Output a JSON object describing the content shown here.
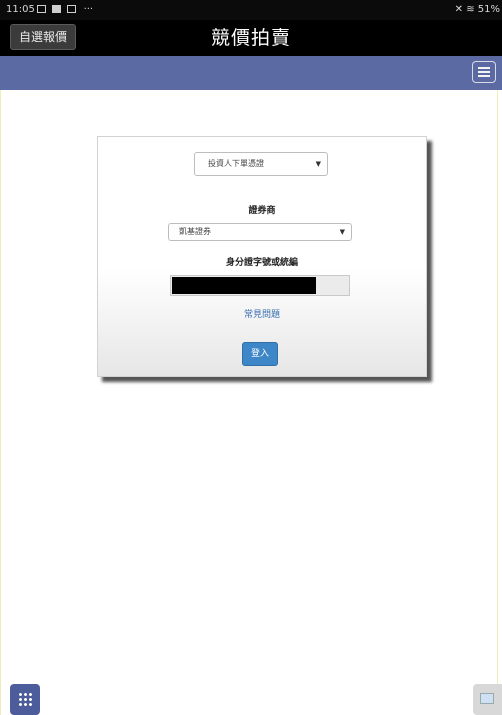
{
  "status_bar": {
    "time": "11:05",
    "icons_left": [
      "image-icon",
      "app-icon",
      "mail-icon"
    ],
    "overflow": "···",
    "battery": "51%"
  },
  "title_bar": {
    "quote_button": "自選報價",
    "title": "競價拍賣"
  },
  "navbar": {
    "menu_icon": "hamburger-menu-icon",
    "color": "#5b6aa3"
  },
  "login_form": {
    "role_select": "投資人下單憑證",
    "broker_label": "證券商",
    "broker_select": "凱基證券",
    "id_label": "身分證字號或統編",
    "faq_link": "常見問題",
    "login_button": "登入",
    "accent_color": "#3d86c8"
  },
  "floating_buttons": {
    "left": "grid-icon",
    "right": "screen-icon"
  }
}
